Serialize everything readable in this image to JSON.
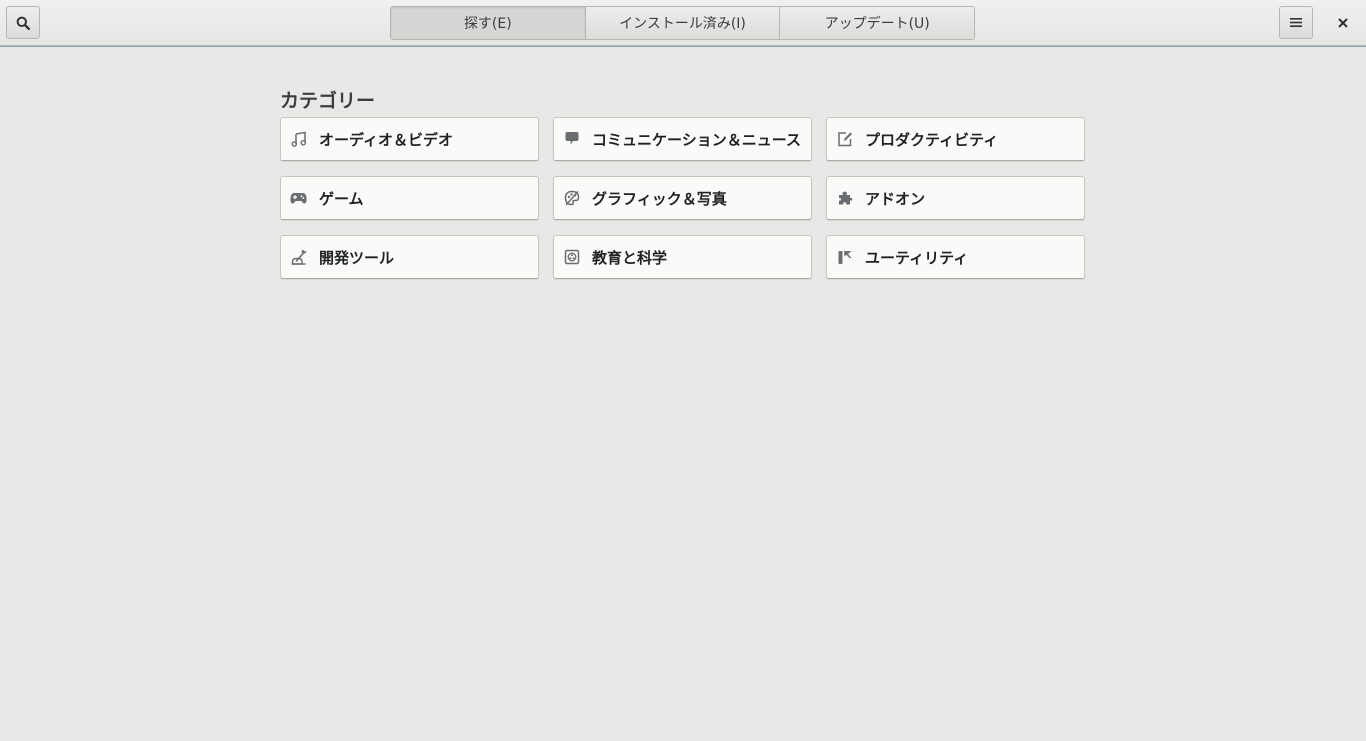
{
  "header": {
    "tabs": [
      {
        "label": "探す(E)",
        "active": true
      },
      {
        "label": "インストール済み(I)",
        "active": false
      },
      {
        "label": "アップデート(U)",
        "active": false
      }
    ],
    "search_icon": "search-icon",
    "menu_icon": "hamburger-menu-icon",
    "close_icon": "close-icon"
  },
  "main": {
    "heading": "カテゴリー",
    "categories": [
      {
        "label": "オーディオ＆ビデオ",
        "icon": "music-note-icon"
      },
      {
        "label": "コミュニケーション＆ニュース",
        "icon": "chat-bubble-icon"
      },
      {
        "label": "プロダクティビティ",
        "icon": "edit-document-icon"
      },
      {
        "label": "ゲーム",
        "icon": "gamepad-icon"
      },
      {
        "label": "グラフィック＆写真",
        "icon": "palette-icon"
      },
      {
        "label": "アドオン",
        "icon": "puzzle-piece-icon"
      },
      {
        "label": "開発ツール",
        "icon": "developer-tools-icon"
      },
      {
        "label": "教育と科学",
        "icon": "science-icon"
      },
      {
        "label": "ユーティリティ",
        "icon": "utilities-icon"
      }
    ]
  },
  "colors": {
    "background": "#e8e8e7",
    "tile": "#fafaf9",
    "icon": "#6b6e70",
    "header_accent": "#8fa1b8"
  }
}
